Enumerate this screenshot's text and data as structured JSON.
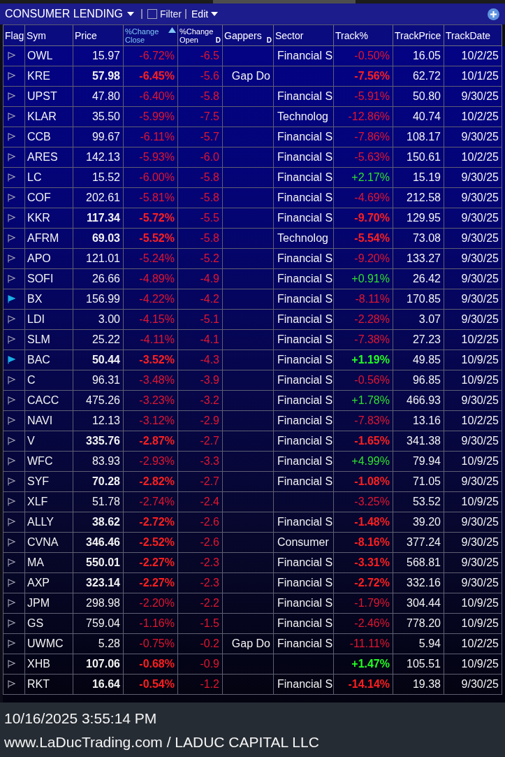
{
  "toolbar": {
    "title": "CONSUMER LENDING",
    "filter": {
      "label": "Filter",
      "checked": false
    },
    "edit_menu": {
      "label": "Edit"
    }
  },
  "table": {
    "columns": [
      {
        "label": "Flag",
        "kind": "plain",
        "sorted": false
      },
      {
        "label": "Sym",
        "kind": "plain",
        "sorted": false
      },
      {
        "label": "Price",
        "kind": "plain",
        "sorted": false
      },
      {
        "label": "%Change Close",
        "kind": "two_line",
        "sorted": true
      },
      {
        "label": "%Change Open",
        "kind": "two_line",
        "sorted": false,
        "marker": "D"
      },
      {
        "label": "Gappers",
        "kind": "plain",
        "sorted": false,
        "marker": "D"
      },
      {
        "label": "Sector",
        "kind": "plain",
        "sorted": false
      },
      {
        "label": "Track%",
        "kind": "plain",
        "sorted": false
      },
      {
        "label": "TrackPrice",
        "kind": "plain",
        "sorted": false
      },
      {
        "label": "TrackDate",
        "kind": "plain",
        "sorted": false
      }
    ],
    "rows": [
      {
        "flagged": false,
        "symbol": "OWL",
        "price": "15.97",
        "change_close": "-6.72%",
        "change_open": "-6.5",
        "sector": "Financial S",
        "track_pct": "-0.50%",
        "track_up": false,
        "track_price": "16.05",
        "track_date": "10/2/25",
        "bold": false
      },
      {
        "flagged": false,
        "symbol": "KRE",
        "price": "57.98",
        "change_close": "-6.45%",
        "change_open": "-5.6",
        "gappers": "Gap Do",
        "track_pct": "-7.56%",
        "track_up": false,
        "track_price": "62.72",
        "track_date": "10/1/25",
        "bold": true
      },
      {
        "flagged": false,
        "symbol": "UPST",
        "price": "47.80",
        "change_close": "-6.40%",
        "change_open": "-5.8",
        "sector": "Financial S",
        "track_pct": "-5.91%",
        "track_up": false,
        "track_price": "50.80",
        "track_date": "9/30/25",
        "bold": false
      },
      {
        "flagged": false,
        "symbol": "KLAR",
        "price": "35.50",
        "change_close": "-5.99%",
        "change_open": "-7.5",
        "sector": "Technolog",
        "track_pct": "-12.86%",
        "track_up": false,
        "track_price": "40.74",
        "track_date": "10/2/25",
        "bold": false
      },
      {
        "flagged": false,
        "symbol": "CCB",
        "price": "99.67",
        "change_close": "-6.11%",
        "change_open": "-5.7",
        "sector": "Financial S",
        "track_pct": "-7.86%",
        "track_up": false,
        "track_price": "108.17",
        "track_date": "9/30/25",
        "bold": false
      },
      {
        "flagged": false,
        "symbol": "ARES",
        "price": "142.13",
        "change_close": "-5.93%",
        "change_open": "-6.0",
        "sector": "Financial S",
        "track_pct": "-5.63%",
        "track_up": false,
        "track_price": "150.61",
        "track_date": "10/2/25",
        "bold": false
      },
      {
        "flagged": false,
        "symbol": "LC",
        "price": "15.52",
        "change_close": "-6.00%",
        "change_open": "-5.8",
        "sector": "Financial S",
        "track_pct": "+2.17%",
        "track_up": true,
        "track_price": "15.19",
        "track_date": "9/30/25",
        "bold": false
      },
      {
        "flagged": false,
        "symbol": "COF",
        "price": "202.61",
        "change_close": "-5.81%",
        "change_open": "-5.8",
        "sector": "Financial S",
        "track_pct": "-4.69%",
        "track_up": false,
        "track_price": "212.58",
        "track_date": "9/30/25",
        "bold": false
      },
      {
        "flagged": false,
        "symbol": "KKR",
        "price": "117.34",
        "change_close": "-5.72%",
        "change_open": "-5.5",
        "sector": "Financial S",
        "track_pct": "-9.70%",
        "track_up": false,
        "track_price": "129.95",
        "track_date": "9/30/25",
        "bold": true
      },
      {
        "flagged": false,
        "symbol": "AFRM",
        "price": "69.03",
        "change_close": "-5.52%",
        "change_open": "-5.8",
        "sector": "Technolog",
        "track_pct": "-5.54%",
        "track_up": false,
        "track_price": "73.08",
        "track_date": "9/30/25",
        "bold": true
      },
      {
        "flagged": false,
        "symbol": "APO",
        "price": "121.01",
        "change_close": "-5.24%",
        "change_open": "-5.2",
        "sector": "Financial S",
        "track_pct": "-9.20%",
        "track_up": false,
        "track_price": "133.27",
        "track_date": "9/30/25",
        "bold": false
      },
      {
        "flagged": false,
        "symbol": "SOFI",
        "price": "26.66",
        "change_close": "-4.89%",
        "change_open": "-4.9",
        "sector": "Financial S",
        "track_pct": "+0.91%",
        "track_up": true,
        "track_price": "26.42",
        "track_date": "9/30/25",
        "bold": false
      },
      {
        "flagged": true,
        "symbol": "BX",
        "price": "156.99",
        "change_close": "-4.22%",
        "change_open": "-4.2",
        "sector": "Financial S",
        "track_pct": "-8.11%",
        "track_up": false,
        "track_price": "170.85",
        "track_date": "9/30/25",
        "bold": false
      },
      {
        "flagged": false,
        "symbol": "LDI",
        "price": "3.00",
        "change_close": "-4.15%",
        "change_open": "-5.1",
        "sector": "Financial S",
        "track_pct": "-2.28%",
        "track_up": false,
        "track_price": "3.07",
        "track_date": "9/30/25",
        "bold": false
      },
      {
        "flagged": false,
        "symbol": "SLM",
        "price": "25.22",
        "change_close": "-4.11%",
        "change_open": "-4.1",
        "sector": "Financial S",
        "track_pct": "-7.38%",
        "track_up": false,
        "track_price": "27.23",
        "track_date": "10/2/25",
        "bold": false
      },
      {
        "flagged": true,
        "symbol": "BAC",
        "price": "50.44",
        "change_close": "-3.52%",
        "change_open": "-4.3",
        "sector": "Financial S",
        "track_pct": "+1.19%",
        "track_up": true,
        "track_price": "49.85",
        "track_date": "10/9/25",
        "bold": true
      },
      {
        "flagged": false,
        "symbol": "C",
        "price": "96.31",
        "change_close": "-3.48%",
        "change_open": "-3.9",
        "sector": "Financial S",
        "track_pct": "-0.56%",
        "track_up": false,
        "track_price": "96.85",
        "track_date": "10/9/25",
        "bold": false
      },
      {
        "flagged": false,
        "symbol": "CACC",
        "price": "475.26",
        "change_close": "-3.23%",
        "change_open": "-3.2",
        "sector": "Financial S",
        "track_pct": "+1.78%",
        "track_up": true,
        "track_price": "466.93",
        "track_date": "9/30/25",
        "bold": false
      },
      {
        "flagged": false,
        "symbol": "NAVI",
        "price": "12.13",
        "change_close": "-3.12%",
        "change_open": "-2.9",
        "sector": "Financial S",
        "track_pct": "-7.83%",
        "track_up": false,
        "track_price": "13.16",
        "track_date": "10/2/25",
        "bold": false
      },
      {
        "flagged": false,
        "symbol": "V",
        "price": "335.76",
        "change_close": "-2.87%",
        "change_open": "-2.7",
        "sector": "Financial S",
        "track_pct": "-1.65%",
        "track_up": false,
        "track_price": "341.38",
        "track_date": "9/30/25",
        "bold": true
      },
      {
        "flagged": false,
        "symbol": "WFC",
        "price": "83.93",
        "change_close": "-2.93%",
        "change_open": "-3.3",
        "sector": "Financial S",
        "track_pct": "+4.99%",
        "track_up": true,
        "track_price": "79.94",
        "track_date": "10/9/25",
        "bold": false
      },
      {
        "flagged": false,
        "symbol": "SYF",
        "price": "70.28",
        "change_close": "-2.82%",
        "change_open": "-2.7",
        "sector": "Financial S",
        "track_pct": "-1.08%",
        "track_up": false,
        "track_price": "71.05",
        "track_date": "9/30/25",
        "bold": true
      },
      {
        "flagged": false,
        "symbol": "XLF",
        "price": "51.78",
        "change_close": "-2.74%",
        "change_open": "-2.4",
        "track_pct": "-3.25%",
        "track_up": false,
        "track_price": "53.52",
        "track_date": "10/9/25",
        "bold": false
      },
      {
        "flagged": false,
        "symbol": "ALLY",
        "price": "38.62",
        "change_close": "-2.72%",
        "change_open": "-2.6",
        "sector": "Financial S",
        "track_pct": "-1.48%",
        "track_up": false,
        "track_price": "39.20",
        "track_date": "9/30/25",
        "bold": true
      },
      {
        "flagged": false,
        "symbol": "CVNA",
        "price": "346.46",
        "change_close": "-2.52%",
        "change_open": "-2.6",
        "sector": "Consumer",
        "track_pct": "-8.16%",
        "track_up": false,
        "track_price": "377.24",
        "track_date": "9/30/25",
        "bold": true
      },
      {
        "flagged": false,
        "symbol": "MA",
        "price": "550.01",
        "change_close": "-2.27%",
        "change_open": "-2.3",
        "sector": "Financial S",
        "track_pct": "-3.31%",
        "track_up": false,
        "track_price": "568.81",
        "track_date": "9/30/25",
        "bold": true
      },
      {
        "flagged": false,
        "symbol": "AXP",
        "price": "323.14",
        "change_close": "-2.27%",
        "change_open": "-2.3",
        "sector": "Financial S",
        "track_pct": "-2.72%",
        "track_up": false,
        "track_price": "332.16",
        "track_date": "9/30/25",
        "bold": true
      },
      {
        "flagged": false,
        "symbol": "JPM",
        "price": "298.98",
        "change_close": "-2.20%",
        "change_open": "-2.2",
        "sector": "Financial S",
        "track_pct": "-1.79%",
        "track_up": false,
        "track_price": "304.44",
        "track_date": "10/9/25",
        "bold": false
      },
      {
        "flagged": false,
        "symbol": "GS",
        "price": "759.04",
        "change_close": "-1.16%",
        "change_open": "-1.5",
        "sector": "Financial S",
        "track_pct": "-2.46%",
        "track_up": false,
        "track_price": "778.20",
        "track_date": "10/9/25",
        "bold": false
      },
      {
        "flagged": false,
        "symbol": "UWMC",
        "price": "5.28",
        "change_close": "-0.75%",
        "change_open": "-0.2",
        "gappers": "Gap Do",
        "sector": "Financial S",
        "track_pct": "-11.11%",
        "track_up": false,
        "track_price": "5.94",
        "track_date": "10/2/25",
        "bold": false
      },
      {
        "flagged": false,
        "symbol": "XHB",
        "price": "107.06",
        "change_close": "-0.68%",
        "change_open": "-0.9",
        "track_pct": "+1.47%",
        "track_up": true,
        "track_price": "105.51",
        "track_date": "10/9/25",
        "bold": true
      },
      {
        "flagged": false,
        "symbol": "RKT",
        "price": "16.64",
        "change_close": "-0.54%",
        "change_open": "-1.2",
        "sector": "Financial S",
        "track_pct": "-14.14%",
        "track_up": false,
        "track_price": "19.38",
        "track_date": "9/30/25",
        "bold": true
      }
    ]
  },
  "status_bar": {
    "timestamp": "10/16/2025 3:55:14 PM",
    "caption": "www.LaDucTrading.com / LADUC CAPITAL LLC"
  }
}
